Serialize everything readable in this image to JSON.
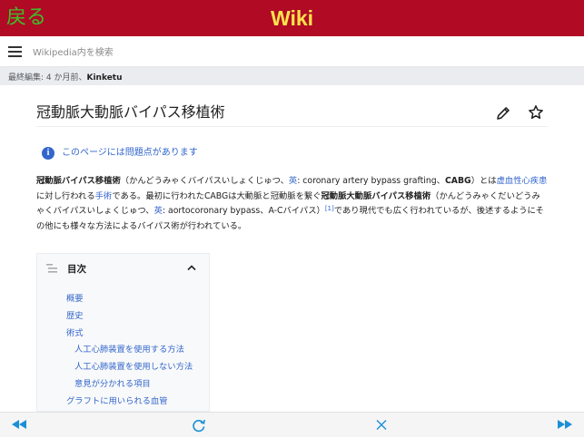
{
  "topbar": {
    "back_label": "戻る",
    "title": "Wiki"
  },
  "search": {
    "placeholder": "Wikipedia内を検索"
  },
  "last_edit": {
    "prefix": "最終編集: 4 か月前、",
    "user": "Kinketu"
  },
  "article": {
    "title": "冠動脈大動脈バイパス移植術",
    "issues_link": "このページには問題点があります",
    "lead": {
      "t1": "冠動脈バイパス移植術",
      "t2": "（かんどうみゃくバイパスいしょくじゅつ、",
      "t3": "英",
      "t4": ": coronary artery bypass grafting、",
      "t5": "CABG",
      "t6": "）とは",
      "t7": "虚血性心疾患",
      "t8": "に対し行われる",
      "t9": "手術",
      "t10": "である。最初に行われたCABGは大動脈と冠動脈を繋ぐ",
      "t11": "冠動脈大動脈バイパス移植術",
      "t12": "（かんどうみゃくだいどうみゃくバイパスいしょくじゅつ、",
      "t13": "英",
      "t14": ": aortocoronary bypass、A-Cバイパス）",
      "t15": "[1]",
      "t16": "であり現代でも広く行われているが、後述するようにその他にも様々な方法によるバイパス術が行われている。"
    }
  },
  "toc": {
    "title": "目次",
    "items": [
      {
        "label": "概要"
      },
      {
        "label": "歴史"
      },
      {
        "label": "術式"
      },
      {
        "label": "人工心肺装置を使用する方法"
      },
      {
        "label": "人工心肺装置を使用しない方法"
      },
      {
        "label": "意見が分かれる項目"
      },
      {
        "label": "グラフトに用いられる血管"
      }
    ]
  },
  "colors": {
    "topbar": "#b00a25",
    "back": "#3fbf2a",
    "title": "#ffe34a",
    "link": "#3366cc",
    "toolbar_icon": "#1a8fd6"
  },
  "icons": {
    "back": "back-arrow-icon",
    "menu": "hamburger-icon",
    "edit": "pencil-icon",
    "watch": "star-icon",
    "info": "info-icon",
    "toc": "list-icon",
    "collapse": "chevron-up-icon",
    "rewind": "rewind-icon",
    "reload": "reload-icon",
    "close": "close-icon",
    "forward": "fast-forward-icon"
  }
}
